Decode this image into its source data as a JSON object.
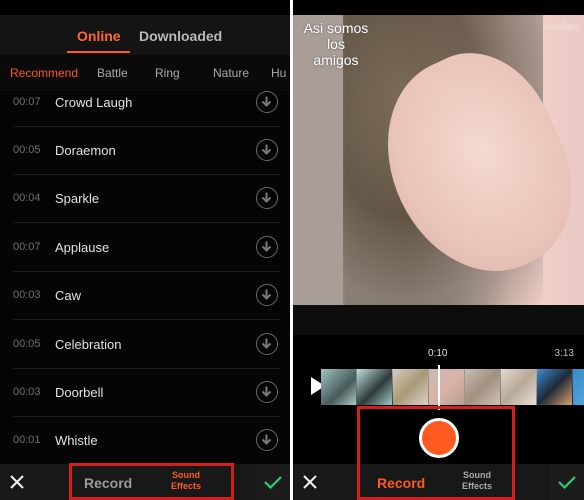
{
  "left_panel": {
    "tabs": [
      {
        "label": "Online",
        "active": true
      },
      {
        "label": "Downloaded",
        "active": false
      }
    ],
    "categories": [
      {
        "label": "Recommend",
        "active": true
      },
      {
        "label": "Battle",
        "active": false
      },
      {
        "label": "Ring",
        "active": false
      },
      {
        "label": "Nature",
        "active": false
      },
      {
        "label": "Hu",
        "active": false
      }
    ],
    "sounds": [
      {
        "duration": "00:07",
        "name": "Crowd Laugh"
      },
      {
        "duration": "00:05",
        "name": "Doraemon"
      },
      {
        "duration": "00:04",
        "name": "Sparkle"
      },
      {
        "duration": "00:07",
        "name": "Applause"
      },
      {
        "duration": "00:03",
        "name": "Caw"
      },
      {
        "duration": "00:05",
        "name": "Celebration"
      },
      {
        "duration": "00:03",
        "name": "Doorbell"
      },
      {
        "duration": "00:01",
        "name": "Whistle"
      }
    ],
    "bottom_bar": {
      "record_label": "Record",
      "sound_effects_label_line1": "Sound",
      "sound_effects_label_line2": "Effects",
      "active": "Sound Effects"
    }
  },
  "right_panel": {
    "video_caption_line1": "Asi somos",
    "video_caption_line2": "los",
    "video_caption_line3": "amigos",
    "watermark": "ewsflare",
    "current_time": "0:10",
    "total_time": "3:13",
    "bottom_bar": {
      "record_label": "Record",
      "sound_effects_label_line1": "Sound",
      "sound_effects_label_line2": "Effects",
      "active": "Record"
    }
  },
  "colors": {
    "accent": "#ff5a1f",
    "highlight_box": "#d41f1f",
    "confirm": "#2ecc71"
  }
}
